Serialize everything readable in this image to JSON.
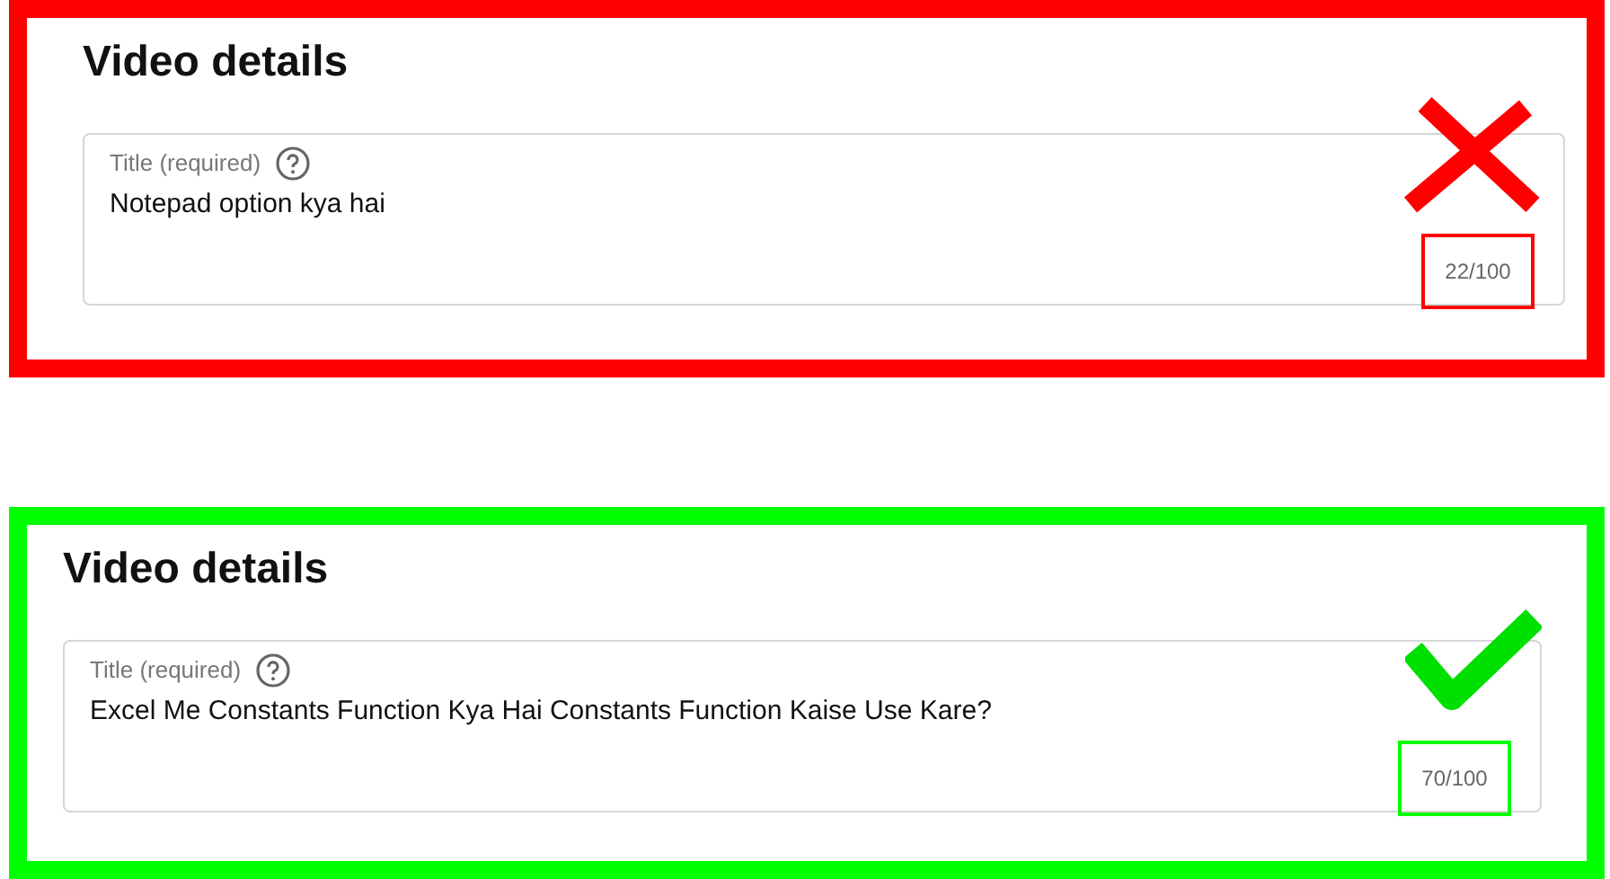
{
  "panels": [
    {
      "correct": false,
      "heading": "Video details",
      "field": {
        "label": "Title (required)",
        "value": "Notepad option kya hai",
        "counter": "22/100"
      }
    },
    {
      "correct": true,
      "heading": "Video details",
      "field": {
        "label": "Title (required)",
        "value": "Excel Me Constants Function Kya Hai Constants Function Kaise Use Kare?",
        "counter": "70/100"
      }
    }
  ]
}
